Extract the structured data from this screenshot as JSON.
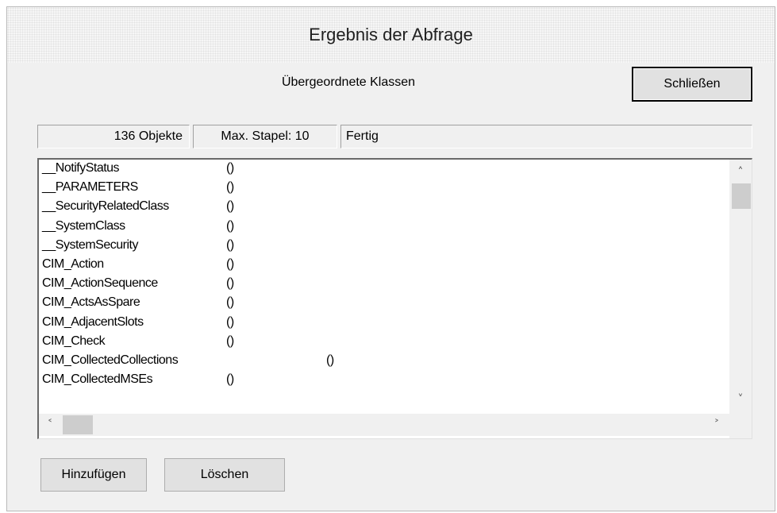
{
  "window": {
    "title": "Ergebnis der Abfrage"
  },
  "header": {
    "label": "Übergeordnete Klassen",
    "close_label": "Schließen"
  },
  "status": {
    "count": "136 Objekte",
    "batch": "Max. Stapel: 10",
    "state": "Fertig"
  },
  "list": {
    "rows": [
      {
        "name": "__NotifyStatus",
        "value": "()"
      },
      {
        "name": "__PARAMETERS",
        "value": "()"
      },
      {
        "name": "__SecurityRelatedClass",
        "value": "()"
      },
      {
        "name": "__SystemClass",
        "value": "()"
      },
      {
        "name": "__SystemSecurity",
        "value": "()"
      },
      {
        "name": "CIM_Action",
        "value": "()"
      },
      {
        "name": "CIM_ActionSequence",
        "value": "()"
      },
      {
        "name": "CIM_ActsAsSpare",
        "value": "()"
      },
      {
        "name": "CIM_AdjacentSlots",
        "value": "()"
      },
      {
        "name": "CIM_Check",
        "value": "()"
      },
      {
        "name": "CIM_CollectedCollections",
        "value": "()"
      },
      {
        "name": "CIM_CollectedMSEs",
        "value": "()"
      }
    ]
  },
  "scroll": {
    "up": "up-arrow-icon",
    "down": "down-arrow-icon",
    "left": "left-arrow-icon",
    "right": "right-arrow-icon"
  },
  "footer": {
    "add_label": "Hinzufügen",
    "delete_label": "Löschen"
  }
}
